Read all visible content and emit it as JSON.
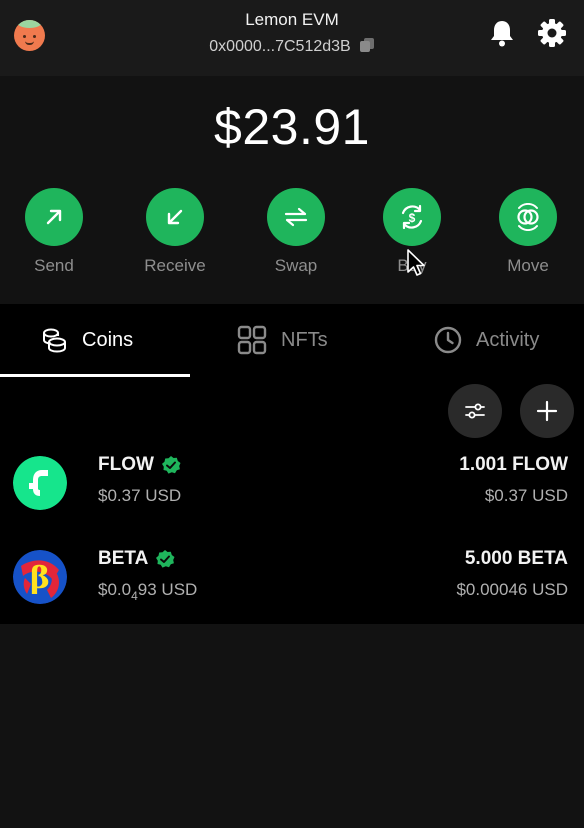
{
  "header": {
    "wallet_name": "Lemon EVM",
    "address": "0x0000...7C512d3B"
  },
  "balance": "$23.91",
  "actions": [
    {
      "label": "Send",
      "icon": "arrow-up-right-icon"
    },
    {
      "label": "Receive",
      "icon": "arrow-down-left-icon"
    },
    {
      "label": "Swap",
      "icon": "swap-arrows-icon"
    },
    {
      "label": "Buy",
      "icon": "dollar-cycle-icon"
    },
    {
      "label": "Move",
      "icon": "move-rings-icon"
    }
  ],
  "tabs": [
    {
      "label": "Coins",
      "icon": "coins-icon",
      "active": true
    },
    {
      "label": "NFTs",
      "icon": "grid-icon",
      "active": false
    },
    {
      "label": "Activity",
      "icon": "clock-icon",
      "active": false
    }
  ],
  "tokens": [
    {
      "symbol": "FLOW",
      "usd_price_label": "$0.37 USD",
      "amount": "1.001 FLOW",
      "value": "$0.37 USD",
      "verified": true
    },
    {
      "symbol": "BETA",
      "usd_price_prefix": "$0.0",
      "usd_price_sub": "4",
      "usd_price_suffix": "93 USD",
      "amount": "5.000 BETA",
      "value": "$0.00046 USD",
      "verified": true
    }
  ],
  "colors": {
    "accent_green": "#1fb55c",
    "header_bg": "#1a1a1a",
    "content_bg": "#000000",
    "page_bg": "#121212"
  }
}
